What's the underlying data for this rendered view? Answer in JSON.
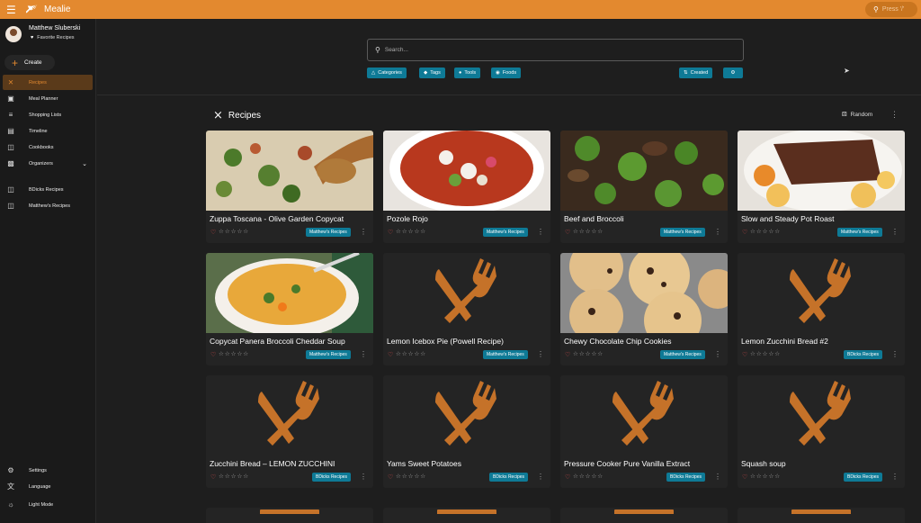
{
  "app": {
    "title": "Mealie",
    "press_label": "Press '/'",
    "accent": "#e3892f"
  },
  "user": {
    "name": "Matthew Sluberski",
    "favorites_label": "Favorite Recipes"
  },
  "sidebar": {
    "create_label": "Create",
    "items": [
      {
        "label": "Recipes",
        "icon": "fork-knife-icon"
      },
      {
        "label": "Meal Planner",
        "icon": "calendar-icon"
      },
      {
        "label": "Shopping Lists",
        "icon": "list-checks-icon"
      },
      {
        "label": "Timeline",
        "icon": "timeline-icon"
      },
      {
        "label": "Cookbooks",
        "icon": "book-icon"
      },
      {
        "label": "Organizers",
        "icon": "folder-icon"
      }
    ],
    "groups": [
      {
        "label": "BDicks Recipes"
      },
      {
        "label": "Matthew's Recipes"
      }
    ],
    "bottom": [
      {
        "label": "Settings"
      },
      {
        "label": "Language"
      },
      {
        "label": "Light Mode"
      }
    ]
  },
  "search": {
    "placeholder": "Search..."
  },
  "filters": {
    "categories": "Categories",
    "tags": "Tags",
    "tools": "Tools",
    "foods": "Foods",
    "sort": "Created"
  },
  "recipes_header": {
    "title": "Recipes",
    "random_label": "Random"
  },
  "recipes": [
    {
      "title": "Zuppa Toscana - Olive Garden Copycat",
      "tag": "Matthew's Recipes",
      "image": "soup"
    },
    {
      "title": "Pozole Rojo",
      "tag": "Matthew's Recipes",
      "image": "pozole"
    },
    {
      "title": "Beef and Broccoli",
      "tag": "Matthew's Recipes",
      "image": "broccoli"
    },
    {
      "title": "Slow and Steady Pot Roast",
      "tag": "Matthew's Recipes",
      "image": "roast"
    },
    {
      "title": "Copycat Panera Broccoli Cheddar Soup",
      "tag": "Matthew's Recipes",
      "image": "cheddar"
    },
    {
      "title": "Lemon Icebox Pie (Powell Recipe)",
      "tag": "Matthew's Recipes",
      "image": "placeholder"
    },
    {
      "title": "Chewy Chocolate Chip Cookies",
      "tag": "Matthew's Recipes",
      "image": "cookies"
    },
    {
      "title": "Lemon Zucchini Bread #2",
      "tag": "BDicks Recipes",
      "image": "placeholder"
    },
    {
      "title": "Zucchini Bread – LEMON ZUCCHINI",
      "tag": "BDicks Recipes",
      "image": "placeholder"
    },
    {
      "title": "Yams Sweet Potatoes",
      "tag": "BDicks Recipes",
      "image": "placeholder"
    },
    {
      "title": "Pressure Cooker Pure Vanilla Extract",
      "tag": "BDicks Recipes",
      "image": "placeholder"
    },
    {
      "title": "Squash soup",
      "tag": "BDicks Recipes",
      "image": "placeholder"
    }
  ]
}
